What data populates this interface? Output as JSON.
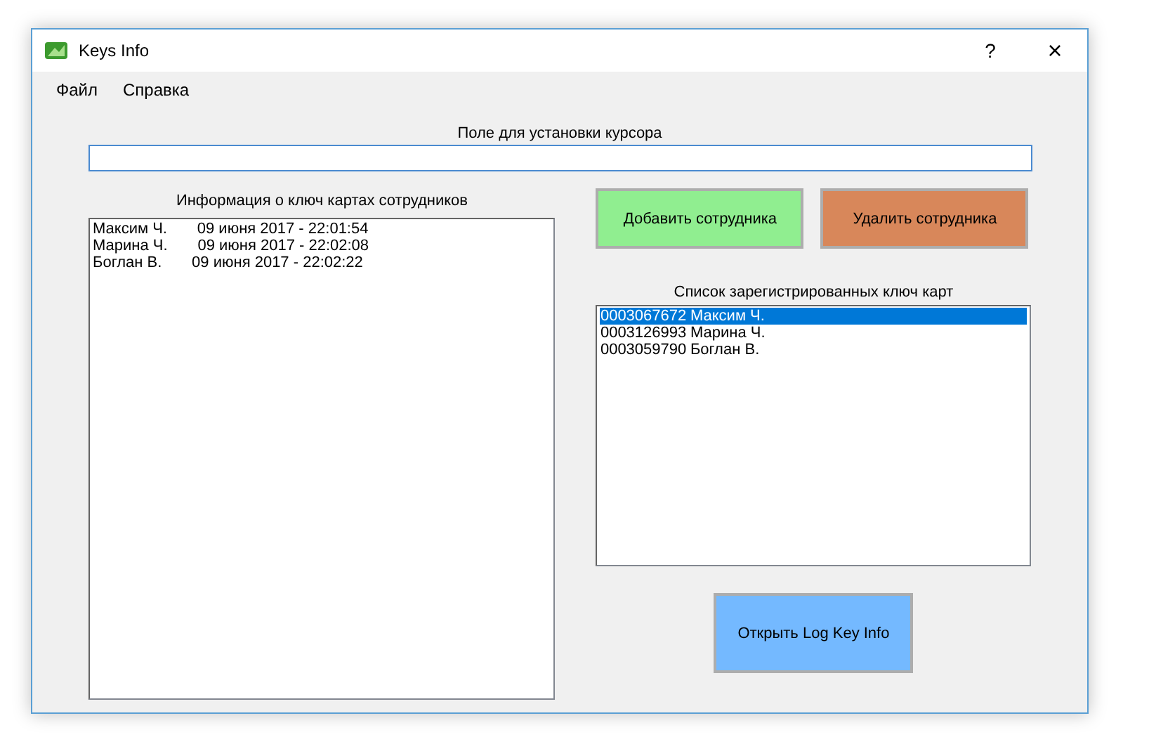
{
  "window": {
    "title": "Keys Info",
    "help": "?",
    "close": "×"
  },
  "menu": [
    "Файл",
    "Справка"
  ],
  "cursor_field": {
    "label": "Поле для установки курсора"
  },
  "info_list": {
    "label": "Информация о ключ картах сотрудников",
    "lines": [
      "Максим Ч.       09 июня 2017 - 22:01:54",
      "Марина Ч.       09 июня 2017 - 22:02:08",
      "Боглан В.       09 июня 2017 - 22:02:22"
    ]
  },
  "add_button": "Добавить сотрудника",
  "delete_button": "Удалить сотрудника",
  "cards_list": {
    "label": "Список зарегистрированных ключ карт",
    "rows": [
      {
        "key": "0003067672",
        "name": "Максим Ч.",
        "selected": true
      },
      {
        "key": "0003126993",
        "name": "Марина Ч.",
        "selected": false
      },
      {
        "key": "0003059790",
        "name": "Боглан В.",
        "selected": false
      }
    ]
  },
  "open_log_button": "Открыть Log Key Info"
}
